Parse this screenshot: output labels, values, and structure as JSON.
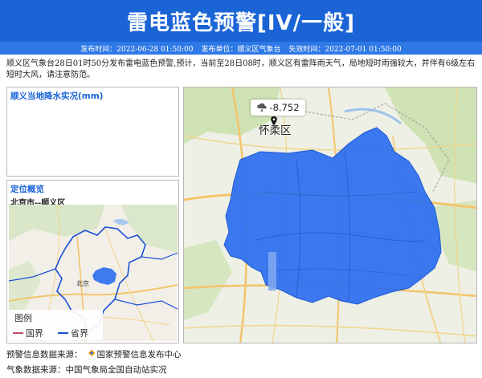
{
  "header": {
    "title": "雷电蓝色预警[IV/一般]"
  },
  "meta": {
    "issue_time": "发布时间：2022-06-28 01:50:00",
    "issuer": "发布单位：顺义区气象台",
    "expire_time": "失效时间：2022-07-01 01:50:00"
  },
  "description": "顺义区气象台28日01时50分发布雷电蓝色预警,预计，当前至28日08时，顺义区有雷阵雨天气，局地短时雨强较大，并伴有6级左右短时大风，请注意防范。",
  "rain_panel": {
    "title": "顺义当地降水实况(mm)"
  },
  "location_panel": {
    "title": "定位概览",
    "subtitle": "北京市--顺义区",
    "map_label": "北京"
  },
  "legend": {
    "title": "图例",
    "items": [
      {
        "label": "国界",
        "color": "#c0506a"
      },
      {
        "label": "省界",
        "color": "#1a4fd6"
      }
    ]
  },
  "main_map": {
    "readout_value": "-8.752",
    "readout_icon": "thunderstorm-icon",
    "place_label": "怀柔区",
    "region_color": "#2b6ef0"
  },
  "footer": {
    "warning_source": "预警信息数据来源：",
    "warning_source_name": "国家预警信息发布中心",
    "weather_source": "气象数据来源：中国气象局全国自动站实况"
  }
}
